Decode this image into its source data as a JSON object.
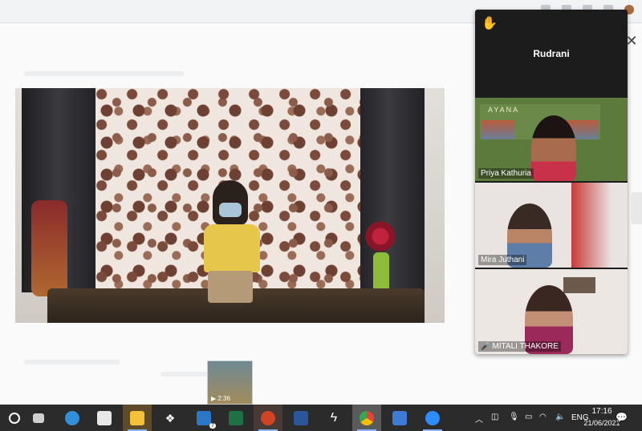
{
  "zoom": {
    "active_speaker": "Rudrani",
    "participants": [
      {
        "name": "Priya Kathuria",
        "muted": false
      },
      {
        "name": "Mira Juthani",
        "muted": false
      },
      {
        "name": "MITALI THAKORE",
        "muted": true
      }
    ],
    "ayana_logo": "AYANA"
  },
  "thumbnail": {
    "duration": "2:36"
  },
  "taskbar": {
    "language": "ENG",
    "time": "17:16",
    "date": "21/06/2021",
    "mail_badge": "7",
    "apps": [
      "start",
      "task-view",
      "edge",
      "store",
      "file-explorer",
      "dropbox",
      "mail",
      "excel",
      "powerpoint",
      "word",
      "app-s",
      "chrome",
      "photos",
      "zoom"
    ]
  },
  "colors": {
    "accent": "#8ab4f8",
    "zoom_bg": "#1c1c1c",
    "taskbar": "#2b2b2b"
  }
}
